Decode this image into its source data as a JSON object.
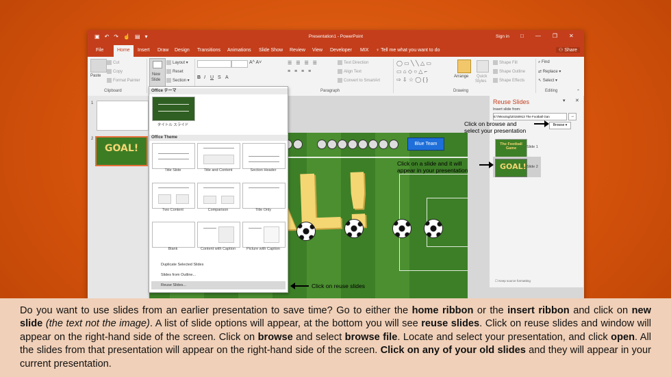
{
  "window": {
    "title": "Presentation1 - PowerPoint",
    "sign_in": "Sign in",
    "window_controls": [
      "□",
      "—",
      "❐",
      "✕"
    ]
  },
  "menu": {
    "tabs": [
      "File",
      "Home",
      "Insert",
      "Draw",
      "Design",
      "Transitions",
      "Animations",
      "Slide Show",
      "Review",
      "View",
      "Developer",
      "MIX"
    ],
    "active_tab": "Home",
    "tell_me": "Tell me what you want to do",
    "share": "Share"
  },
  "ribbon": {
    "clipboard": {
      "paste": "Paste",
      "cut": "Cut",
      "copy": "Copy",
      "format_painter": "Format Painter",
      "label": "Clipboard"
    },
    "slides": {
      "new_slide_1": "New",
      "new_slide_2": "Slide",
      "layout": "Layout",
      "reset": "Reset",
      "section": "Section"
    },
    "paragraph": {
      "text_direction": "Text Direction",
      "align_text": "Align Text",
      "smartart": "Convert to SmartArt",
      "label": "Paragraph"
    },
    "drawing": {
      "arrange": "Arrange",
      "quick_styles_1": "Quick",
      "quick_styles_2": "Styles",
      "shape_fill": "Shape Fill",
      "shape_outline": "Shape Outline",
      "shape_effects": "Shape Effects",
      "label": "Drawing"
    },
    "editing": {
      "find": "Find",
      "replace": "Replace",
      "select": "Select",
      "label": "Editing"
    }
  },
  "thumbnails": {
    "slide1_num": "1",
    "slide2_num": "2",
    "slide2_text": "GOAL!"
  },
  "slide": {
    "blue_team": "Blue Team",
    "goal_text": "OAL!"
  },
  "new_slide_menu": {
    "section1": "Office テーマ",
    "section1_layout": "タイトル スライド",
    "section2": "Office Theme",
    "layouts": [
      "Title Slide",
      "Title and Content",
      "Section Header",
      "Two Content",
      "Comparison",
      "Title Only",
      "Blank",
      "Content with Caption",
      "Picture with Caption"
    ],
    "duplicate": "Duplicate Selected Slides",
    "from_outline": "Slides from Outline...",
    "reuse": "Reuse Slides..."
  },
  "reuse_pane": {
    "title": "Reuse Slides",
    "insert_from": "Insert slide from:",
    "path": "E:\\Teknologi\\20150913 The Football Gan",
    "browse": "Browse",
    "slide1_label": "Slide 1",
    "slide2_label": "Slide 2",
    "thumb1_text": "The Football Game",
    "thumb2_text": "GOAL!",
    "keep_format": "Keep source formatting"
  },
  "annotations": {
    "browse_note_1": "Click on browse and",
    "browse_note_2": "select your presentation",
    "slide_note_1": "Click on a slide and it will",
    "slide_note_2": "appear in your presentation",
    "reuse_note": "Click on reuse slides"
  },
  "caption": {
    "p1": "Do you want to use slides from an earlier presentation to save time? Go to either the ",
    "b1": "home ribbon",
    "p2": " or the ",
    "b2": "insert ribbon",
    "p3": " and click on ",
    "b3": "new slide",
    "i1": " (the text not the image)",
    "p4": ". A list of slide options will appear, at the bottom you will see ",
    "b4": "reuse slides",
    "p5": ". Click on reuse slides and window will appear on the right-hand side of the screen. Click on ",
    "b5": "browse",
    "p6": " and select ",
    "b6": "browse file",
    "p7": ". Locate and select your presentation, and click ",
    "b7": "open",
    "p8": ". All the slides from that presentation will appear on the right-hand side of the screen. ",
    "b8": "Click on any of your old slides",
    "p9": " and they will appear in your current presentation."
  },
  "colors": {
    "background": "#d4520b",
    "ribbon_red": "#c43e1c",
    "caption_bg": "#f0d0b8",
    "pitch_green": "#3d7f27",
    "goal_yellow": "#f4d673"
  }
}
